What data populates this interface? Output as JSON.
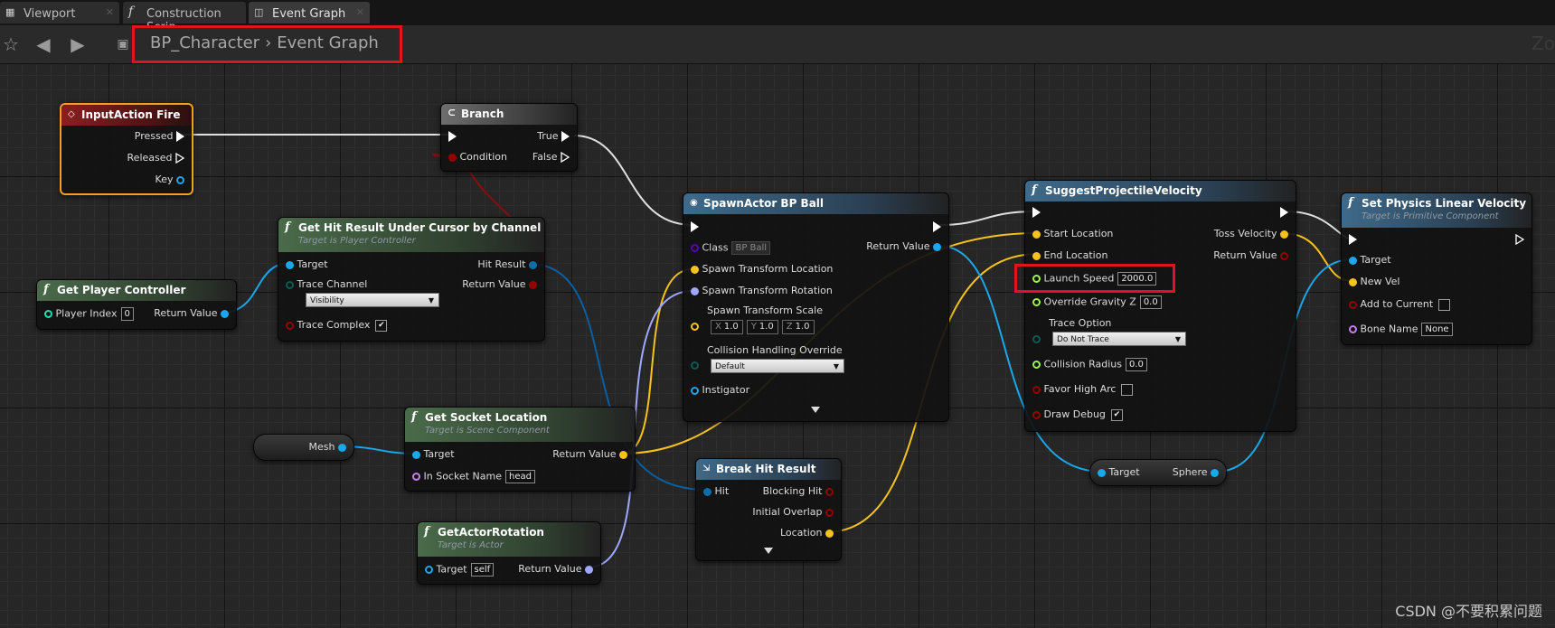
{
  "tabs": [
    {
      "label": "Viewport",
      "icon": "viewport-icon"
    },
    {
      "label": "Construction Scrip",
      "icon": "function-icon"
    },
    {
      "label": "Event Graph",
      "icon": "graph-icon",
      "active": true
    }
  ],
  "breadcrumb": {
    "blueprint": "BP_Character",
    "graph": "Event Graph"
  },
  "zoom_label": "Zo",
  "nodes": {
    "input_action": {
      "title": "InputAction Fire",
      "pins": {
        "pressed": "Pressed",
        "released": "Released",
        "key": "Key"
      }
    },
    "branch": {
      "title": "Branch",
      "pins": {
        "condition": "Condition",
        "true": "True",
        "false": "False"
      }
    },
    "get_player_controller": {
      "title": "Get Player Controller",
      "player_index_label": "Player Index",
      "player_index_value": "0",
      "return_value": "Return Value"
    },
    "get_hit_result": {
      "title": "Get Hit Result Under Cursor by Channel",
      "subtitle": "Target is Player Controller",
      "target": "Target",
      "trace_channel": "Trace Channel",
      "trace_channel_value": "Visibility",
      "trace_complex": "Trace Complex",
      "hit_result": "Hit Result",
      "return_value": "Return Value"
    },
    "spawn_actor": {
      "title": "SpawnActor BP Ball",
      "class_label": "Class",
      "class_value": "BP Ball",
      "return_value": "Return Value",
      "spawn_loc": "Spawn Transform Location",
      "spawn_rot": "Spawn Transform Rotation",
      "spawn_scale": "Spawn Transform Scale",
      "scale_x": "1.0",
      "scale_y": "1.0",
      "scale_z": "1.0",
      "x": "X",
      "y": "Y",
      "z": "Z",
      "collision": "Collision Handling Override",
      "collision_value": "Default",
      "instigator": "Instigator"
    },
    "suggest": {
      "title": "SuggestProjectileVelocity",
      "start": "Start Location",
      "end": "End Location",
      "launch_speed": "Launch Speed",
      "launch_speed_value": "2000.0",
      "override_gravity": "Override Gravity Z",
      "override_gravity_value": "0.0",
      "trace_option": "Trace Option",
      "trace_option_value": "Do Not Trace",
      "collision_radius": "Collision Radius",
      "collision_radius_value": "0.0",
      "favor_high_arc": "Favor High Arc",
      "draw_debug": "Draw Debug",
      "toss_velocity": "Toss Velocity",
      "return_value": "Return Value"
    },
    "set_physics": {
      "title": "Set Physics Linear Velocity",
      "subtitle": "Target is Primitive Component",
      "target": "Target",
      "new_vel": "New Vel",
      "add_to_current": "Add to Current",
      "bone_name": "Bone Name",
      "bone_name_value": "None"
    },
    "mesh": {
      "label": "Mesh"
    },
    "get_socket": {
      "title": "Get Socket Location",
      "subtitle": "Target is Scene Component",
      "target": "Target",
      "socket_name": "In Socket Name",
      "socket_name_value": "head",
      "return_value": "Return Value"
    },
    "get_actor_rotation": {
      "title": "GetActorRotation",
      "subtitle": "Target is Actor",
      "target": "Target",
      "target_value": "self",
      "return_value": "Return Value"
    },
    "break_hit": {
      "title": "Break Hit Result",
      "hit": "Hit",
      "blocking_hit": "Blocking Hit",
      "initial_overlap": "Initial Overlap",
      "location": "Location"
    },
    "sphere_var": {
      "target": "Target",
      "sphere": "Sphere"
    }
  },
  "watermark": "CSDN @不要积累问题",
  "colors": {
    "exec": "#ffffff",
    "object": "#1aa7ec",
    "vector": "#f7c31b",
    "rotator": "#9ea8ff",
    "struct": "#0a6fa8",
    "bool": "#940000",
    "float": "#9cf54c",
    "name": "#c87ef0",
    "int": "#1fe0b0",
    "class": "#5a00b5",
    "highlight": "#e0141e"
  }
}
